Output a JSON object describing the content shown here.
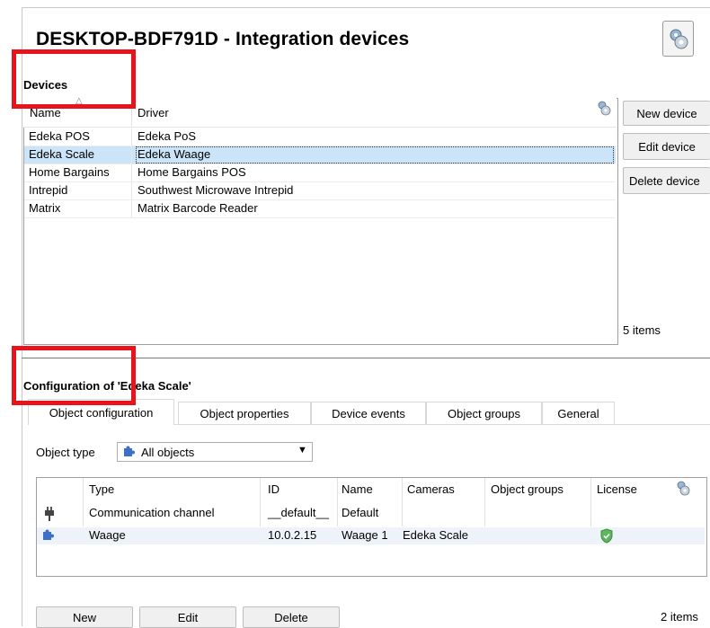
{
  "window": {
    "title": "DESKTOP-BDF791D - Integration devices",
    "settings_icon": "gear-icon"
  },
  "devices": {
    "section_label": "Devices",
    "columns": [
      "Name",
      "Driver"
    ],
    "rows": [
      {
        "name": "Edeka POS",
        "driver": "Edeka PoS"
      },
      {
        "name": "Edeka Scale",
        "driver": "Edeka Waage"
      },
      {
        "name": "Home Bargains",
        "driver": "Home Bargains POS"
      },
      {
        "name": "Intrepid",
        "driver": "Southwest Microwave Intrepid"
      },
      {
        "name": "Matrix",
        "driver": "Matrix Barcode Reader"
      }
    ],
    "selected_index": 1,
    "count_label": "5 items",
    "buttons": {
      "new": "New device",
      "edit": "Edit device",
      "delete": "Delete device"
    }
  },
  "configuration": {
    "section_label": "Configuration of 'Edeka Scale'",
    "tabs": [
      "Object configuration",
      "Object properties",
      "Device events",
      "Object groups",
      "General"
    ],
    "active_tab": 0,
    "object_type_label": "Object type",
    "object_type_value": "All objects",
    "grid_columns": [
      "Type",
      "ID",
      "Name",
      "Cameras",
      "Object groups",
      "License"
    ],
    "grid_rows": [
      {
        "icon": "plug-icon",
        "type": "Communication channel",
        "id": "__default__",
        "name": "Default",
        "cameras": "",
        "groups": "",
        "license": ""
      },
      {
        "icon": "puzzle-icon",
        "type": "Waage",
        "id": "10.0.2.15",
        "name": "Waage 1",
        "cameras": "Edeka Scale",
        "groups": "",
        "license": "shield-check-icon"
      }
    ],
    "buttons": {
      "new": "New",
      "edit": "Edit",
      "delete": "Delete"
    },
    "count_label": "2 items"
  },
  "colors": {
    "selection": "#cce4f7",
    "highlight_box": "#e8141c",
    "license_ok": "#5cb85c"
  }
}
